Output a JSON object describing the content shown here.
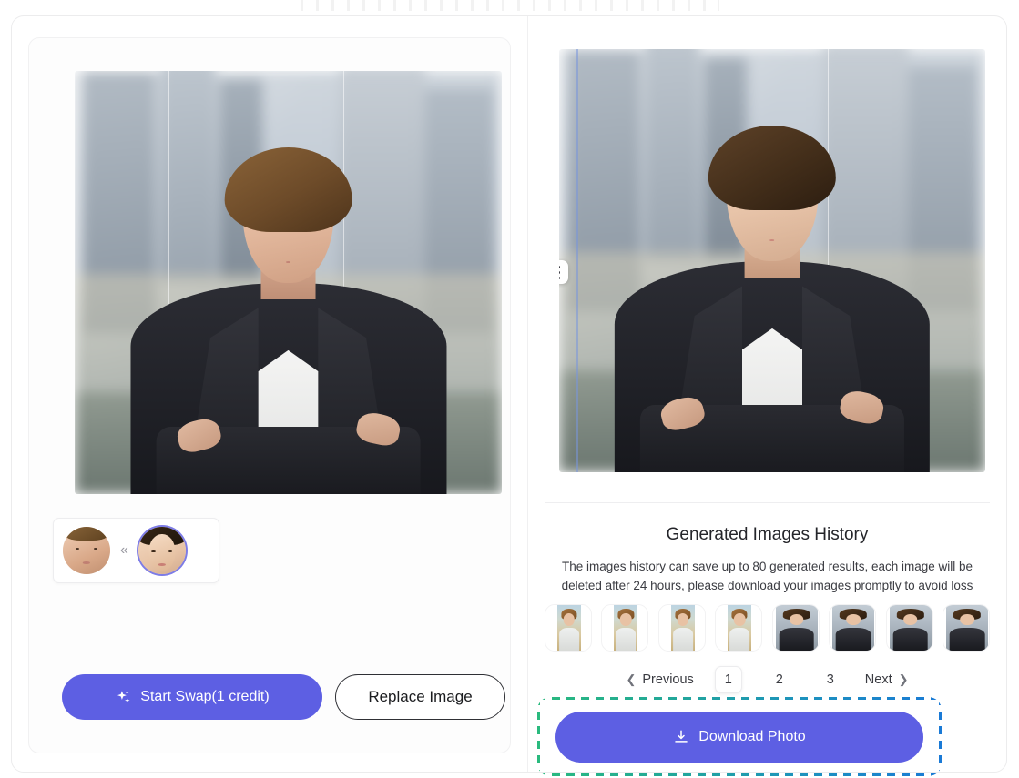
{
  "app": {
    "accent_purple": "#5d5fe3",
    "highlight_gradient_from": "#2aba7e",
    "highlight_gradient_to": "#1a7ad6"
  },
  "left_panel": {
    "source_image_alt": "Source portrait of woman in dark blazer in front of city skyline",
    "face_chips": [
      {
        "name": "source-face",
        "alt": "Original face thumbnail",
        "selected": false
      },
      {
        "name": "target-face",
        "alt": "Replacement face thumbnail",
        "selected": true
      }
    ],
    "chip_separator": "«",
    "actions": {
      "start_swap_label": "Start Swap(1 credit)",
      "start_swap_icon": "sparkle-icon",
      "replace_image_label": "Replace Image"
    }
  },
  "right_panel": {
    "result_image_alt": "Swapped result portrait of woman in dark blazer in front of city skyline",
    "kebab_menu_icon": "more-options-icon",
    "history": {
      "title": "Generated Images History",
      "description": "The images history can save up to 80 generated results, each image will be deleted after 24 hours, please download your images promptly to avoid loss",
      "thumbnails": [
        {
          "alt": "History result 1",
          "style": "field"
        },
        {
          "alt": "History result 2",
          "style": "field"
        },
        {
          "alt": "History result 3",
          "style": "field"
        },
        {
          "alt": "History result 4",
          "style": "field"
        },
        {
          "alt": "History result 5",
          "style": "city"
        },
        {
          "alt": "History result 6",
          "style": "city"
        },
        {
          "alt": "History result 7",
          "style": "city"
        },
        {
          "alt": "History result 8",
          "style": "city"
        }
      ]
    },
    "pagination": {
      "previous_label": "Previous",
      "previous_icon": "chevron-left-icon",
      "pages": [
        "1",
        "2",
        "3"
      ],
      "active_page": "1",
      "next_label": "Next",
      "next_icon": "chevron-right-icon"
    },
    "download": {
      "label": "Download Photo",
      "icon": "download-icon",
      "highlighted": true
    }
  }
}
